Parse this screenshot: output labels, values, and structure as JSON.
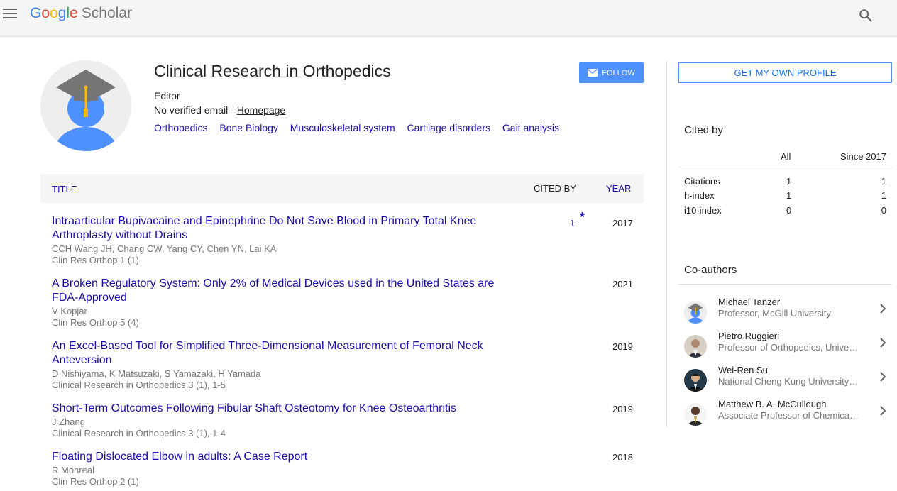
{
  "header": {
    "logo_google": [
      "G",
      "o",
      "o",
      "g",
      "l",
      "e"
    ],
    "logo_scholar": "Scholar"
  },
  "profile": {
    "name": "Clinical Research in Orthopedics",
    "affiliation": "Editor",
    "email_text": "No verified email - ",
    "homepage_link": "Homepage",
    "interests": [
      "Orthopedics",
      "Bone Biology",
      "Musculoskeletal system",
      "Cartilage disorders",
      "Gait analysis"
    ],
    "follow_label": "FOLLOW"
  },
  "articles_table": {
    "col_title": "TITLE",
    "col_cited_by": "CITED BY",
    "col_year": "YEAR",
    "rows": [
      {
        "title": "Intraarticular Bupivacaine and Epinephrine Do Not Save Blood in Primary Total Knee Arthroplasty without Drains",
        "authors": "CCH Wang JH, Chang CW, Yang CY, Chen YN, Lai KA",
        "venue": "Clin Res Orthop 1 (1)",
        "cited_by": "1",
        "star": "*",
        "year": "2017"
      },
      {
        "title": "A Broken Regulatory System: Only 2% of Medical Devices used in the United States are FDA-Approved",
        "authors": "V Kopjar",
        "venue": "Clin Res Orthop 5 (4)",
        "cited_by": "",
        "year": "2021"
      },
      {
        "title": "An Excel-Based Tool for Simplified Three-Dimensional Measurement of Femoral Neck Anteversion",
        "authors": "D Nishiyama, K Matsuzaki, S Yamazaki, H Yamada",
        "venue": "Clinical Research in Orthopedics 3 (1), 1-5",
        "cited_by": "",
        "year": "2019"
      },
      {
        "title": "Short-Term Outcomes Following Fibular Shaft Osteotomy for Knee Osteoarthritis",
        "authors": "J Zhang",
        "venue": "Clinical Research in Orthopedics 3 (1), 1-4",
        "cited_by": "",
        "year": "2019"
      },
      {
        "title": "Floating Dislocated Elbow in adults: A Case Report",
        "authors": "R Monreal",
        "venue": "Clin Res Orthop 2 (1)",
        "cited_by": "",
        "year": "2018"
      }
    ]
  },
  "sidebar": {
    "get_profile_label": "GET MY OWN PROFILE",
    "cited_by_title": "Cited by",
    "col_all": "All",
    "col_since": "Since 2017",
    "metrics": [
      {
        "label": "Citations",
        "all": "1",
        "since": "1"
      },
      {
        "label": "h-index",
        "all": "1",
        "since": "1"
      },
      {
        "label": "i10-index",
        "all": "0",
        "since": "0"
      }
    ],
    "coauthors_title": "Co-authors",
    "coauthors": [
      {
        "name": "Michael Tanzer",
        "affiliation": "Professor, McGill University",
        "avatar": "default-scholar-avatar"
      },
      {
        "name": "Pietro Ruggieri",
        "affiliation": "Professor of Orthopedics, University of Padua",
        "avatar": "photo-avatar"
      },
      {
        "name": "Wei-Ren Su",
        "affiliation": "National Cheng Kung University Hospital",
        "avatar": "photo-avatar"
      },
      {
        "name": "Matthew B. A. McCullough",
        "affiliation": "Associate Professor of Chemical, Biological and Bioengineering",
        "avatar": "photo-avatar"
      }
    ]
  }
}
